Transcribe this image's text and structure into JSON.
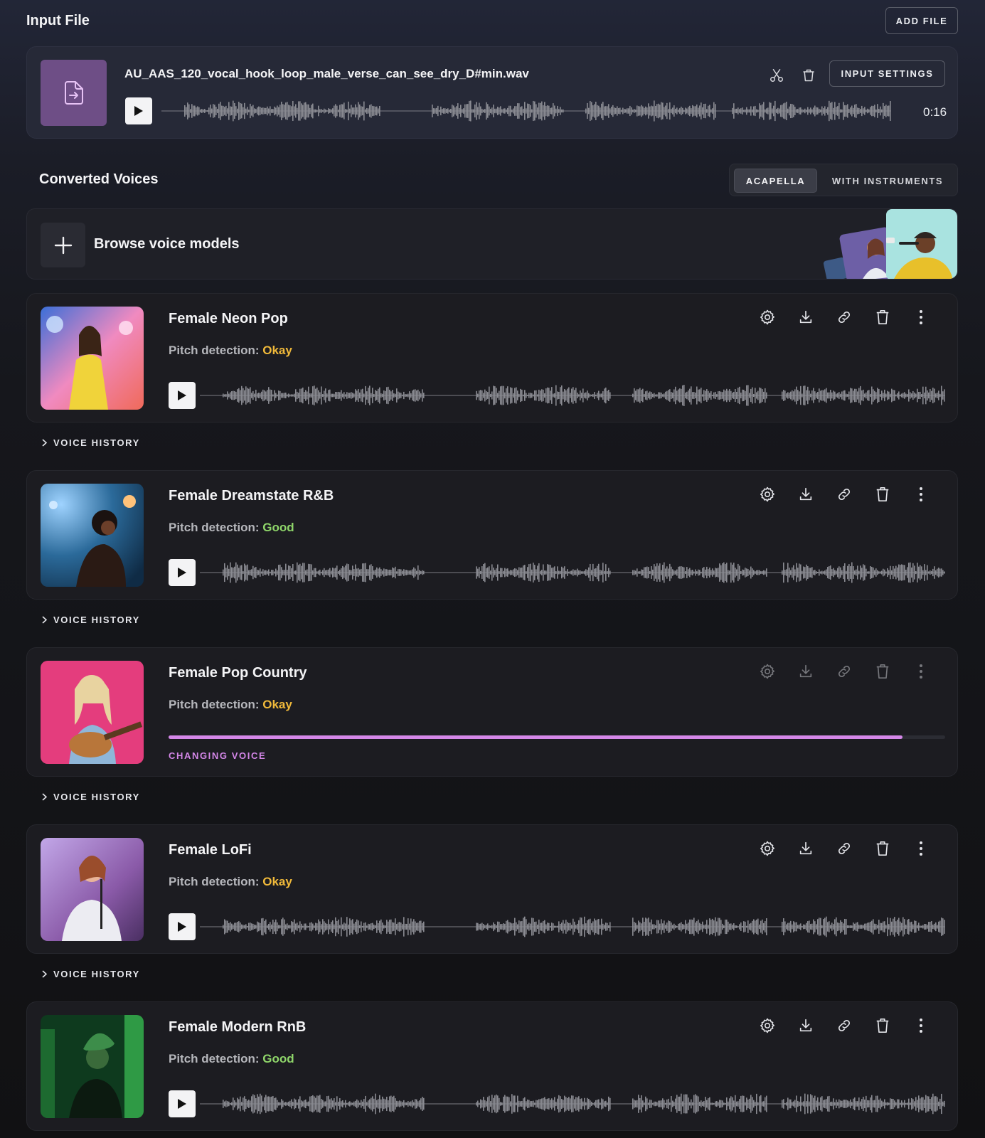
{
  "input_file": {
    "title": "Input File",
    "add_file_label": "ADD FILE",
    "file_name": "AU_AAS_120_vocal_hook_loop_male_verse_can_see_dry_D#min.wav",
    "input_settings_label": "INPUT SETTINGS",
    "duration": "0:16",
    "icons": [
      "file-icon",
      "scissors-icon",
      "trash-icon",
      "play-icon"
    ]
  },
  "converted": {
    "title": "Converted Voices",
    "tabs": [
      {
        "label": "ACAPELLA",
        "selected": true
      },
      {
        "label": "WITH INSTRUMENTS",
        "selected": false
      }
    ],
    "browse_label": "Browse voice models"
  },
  "voices": [
    {
      "name": "Female Neon Pop",
      "pitch_label": "Pitch detection:",
      "pitch_value": "Okay",
      "status_color": "#f0b93a",
      "history_label": "VOICE HISTORY"
    },
    {
      "name": "Female Dreamstate R&B",
      "pitch_label": "Pitch detection:",
      "pitch_value": "Good",
      "status_color": "#8fd66a",
      "history_label": "VOICE HISTORY"
    },
    {
      "name": "Female Pop Country",
      "pitch_label": "Pitch detection:",
      "pitch_value": "Okay",
      "status_color": "#f0b93a",
      "progress_label": "CHANGING VOICE",
      "progress": 0.945,
      "history_label": "VOICE HISTORY"
    },
    {
      "name": "Female LoFi",
      "pitch_label": "Pitch detection:",
      "pitch_value": "Okay",
      "status_color": "#f0b93a",
      "history_label": "VOICE HISTORY"
    },
    {
      "name": "Female Modern RnB",
      "pitch_label": "Pitch detection:",
      "pitch_value": "Good",
      "status_color": "#8fd66a"
    }
  ],
  "colors": {
    "accent": "#d487e8",
    "okay": "#f0b93a",
    "good": "#8fd66a",
    "file_thumb": "#6e4e86"
  }
}
